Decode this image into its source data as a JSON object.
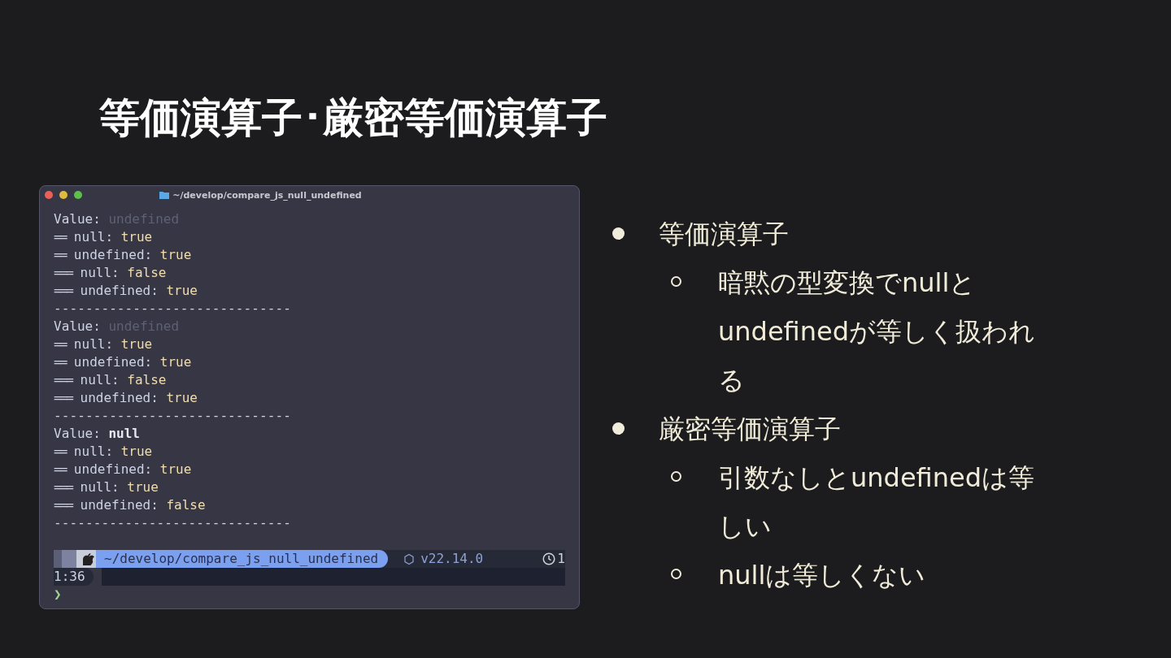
{
  "slide": {
    "title": "等価演算子･厳密等価演算子"
  },
  "terminal": {
    "title": "~/develop/compare_js_null_undefined",
    "blocks": [
      {
        "label": "Value:",
        "value": "undefined",
        "dimmed": true,
        "bold": false,
        "lines": [
          {
            "op": "==",
            "target": "null:",
            "result": "true"
          },
          {
            "op": "==",
            "target": "undefined:",
            "result": "true"
          },
          {
            "op": "===",
            "target": "null:",
            "result": "false"
          },
          {
            "op": "===",
            "target": "undefined:",
            "result": "true"
          }
        ],
        "separator": "------------------------------"
      },
      {
        "label": "Value:",
        "value": "undefined",
        "dimmed": true,
        "bold": false,
        "lines": [
          {
            "op": "==",
            "target": "null:",
            "result": "true"
          },
          {
            "op": "==",
            "target": "undefined:",
            "result": "true"
          },
          {
            "op": "===",
            "target": "null:",
            "result": "false"
          },
          {
            "op": "===",
            "target": "undefined:",
            "result": "true"
          }
        ],
        "separator": "------------------------------"
      },
      {
        "label": "Value:",
        "value": "null",
        "dimmed": false,
        "bold": true,
        "lines": [
          {
            "op": "==",
            "target": "null:",
            "result": "true"
          },
          {
            "op": "==",
            "target": "undefined:",
            "result": "true"
          },
          {
            "op": "===",
            "target": "null:",
            "result": "true"
          },
          {
            "op": "===",
            "target": "undefined:",
            "result": "false"
          }
        ],
        "separator": "------------------------------"
      }
    ],
    "prompt": {
      "path": "~/develop/compare_js_null_undefined",
      "node_version": "v22.14.0",
      "clock_start": "1",
      "clock_rest": "1:36",
      "cursor": "❯"
    }
  },
  "bullets": [
    {
      "text": "等価演算子",
      "children": [
        {
          "text": "暗黙の型変換でnullとundefinedが等しく扱われる"
        }
      ]
    },
    {
      "text": "厳密等価演算子",
      "children": [
        {
          "text": "引数なしとundefinedは等しい"
        },
        {
          "text": "nullは等しくない"
        }
      ]
    }
  ]
}
